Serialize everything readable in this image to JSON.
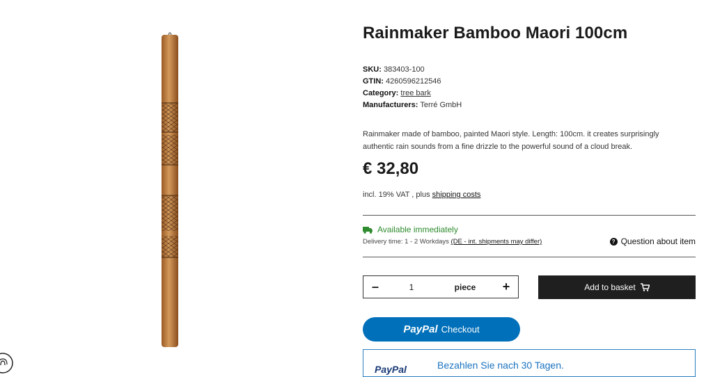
{
  "product": {
    "title": "Rainmaker Bamboo Maori 100cm",
    "sku_label": "SKU:",
    "sku": "383403-100",
    "gtin_label": "GTIN:",
    "gtin": "4260596212546",
    "category_label": "Category:",
    "category": "tree bark",
    "manufacturer_label": "Manufacturers:",
    "manufacturer": "Terré GmbH",
    "description": "Rainmaker made of bamboo, painted Maori style. Length: 100cm. it creates surprisingly authentic rain sounds from a fine drizzle to the powerful sound of a cloud break.",
    "price": "€ 32,80",
    "vat_text": "incl. 19% VAT , plus",
    "shipping_link": "shipping costs"
  },
  "availability": {
    "status": "Available immediately",
    "delivery_text": "Delivery time: 1 - 2 Workdays",
    "delivery_link": "(DE - int. shipments may differ)",
    "question_label": "Question about item"
  },
  "quantity": {
    "minus": "–",
    "value": "1",
    "unit": "piece",
    "plus": "+"
  },
  "buttons": {
    "add_to_basket": "Add to basket",
    "paypal_brand": "PayPal",
    "paypal_checkout": "Checkout"
  },
  "banner": {
    "brand": "PayPal",
    "text": "Bezahlen Sie nach 30 Tagen."
  },
  "colors": {
    "available": "#2e8b2e",
    "paypal": "#0070ba",
    "basket": "#1f1f1f"
  },
  "icons": {
    "truck": "truck-icon",
    "question": "question-icon",
    "cart": "cart-icon"
  }
}
